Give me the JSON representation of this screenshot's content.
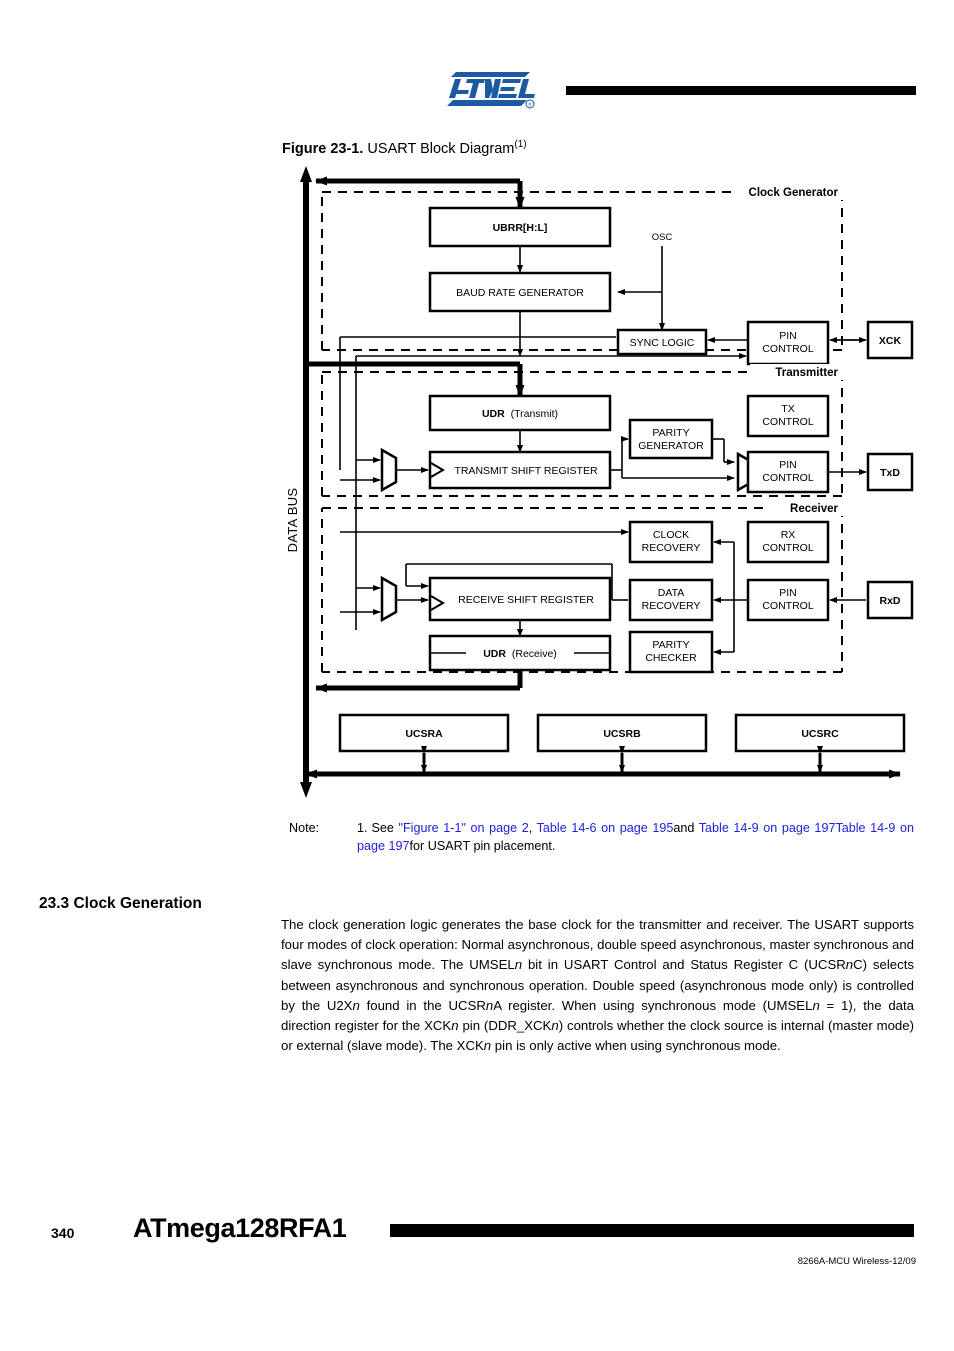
{
  "header": {
    "logo_text": "ATMEL",
    "logo_color": "#1C5BA4",
    "registered_mark": "®"
  },
  "figure": {
    "number": "Figure 23-1.",
    "title": "USART Block Diagram",
    "footnote_marker": "(1)",
    "databus_label": "DATA BUS",
    "sections": [
      {
        "id": "clock-generator",
        "label": "Clock Generator"
      },
      {
        "id": "transmitter",
        "label": "Transmitter"
      },
      {
        "id": "receiver",
        "label": "Receiver"
      }
    ],
    "blocks": {
      "ubrr": "UBRR[H:L]",
      "baud_rate_generator": "BAUD RATE GENERATOR",
      "osc": "OSC",
      "sync_logic": "SYNC LOGIC",
      "clk_pin_control": "PIN\nCONTROL",
      "udr_transmit_bold": "UDR",
      "udr_transmit_plain": "(Transmit)",
      "transmit_shift_register": "TRANSMIT SHIFT REGISTER",
      "parity_generator": "PARITY\nGENERATOR",
      "tx_control": "TX\nCONTROL",
      "tx_pin_control": "PIN\nCONTROL",
      "clock_recovery": "CLOCK\nRECOVERY",
      "rx_control": "RX\nCONTROL",
      "receive_shift_register": "RECEIVE SHIFT REGISTER",
      "data_recovery": "DATA\nRECOVERY",
      "rx_pin_control": "PIN\nCONTROL",
      "udr_receive_bold": "UDR",
      "udr_receive_plain": "(Receive)",
      "parity_checker": "PARITY\nCHECKER"
    },
    "pins": {
      "xck": "XCK",
      "txd": "TxD",
      "rxd": "RxD"
    },
    "registers": [
      {
        "id": "ucsra",
        "label": "UCSRA"
      },
      {
        "id": "ucsrb",
        "label": "UCSRB"
      },
      {
        "id": "ucsrc",
        "label": "UCSRC"
      }
    ]
  },
  "note": {
    "label": "Note:",
    "number": "1.",
    "lead": "See ",
    "links": [
      "\"Figure 1-1\" on page 2",
      "Table 14-6 on page 195",
      "Table 14-9 on page 197",
      "Table 14-9 on page 197"
    ],
    "sep_comma": ", ",
    "sep_and": "and ",
    "tail": "for USART pin placement.",
    "link_color": "#2020E0"
  },
  "section": {
    "heading": "23.3 Clock Generation",
    "paragraph_parts": [
      {
        "text": "The clock generation logic generates the base clock for the transmitter and receiver. The USART supports four modes of clock operation: Normal asynchronous, double speed asynchronous, master synchronous and slave synchronous mode. The UMSEL",
        "style": "normal"
      },
      {
        "text": "n",
        "style": "italic"
      },
      {
        "text": " bit in USART Control and Status Register C (UCSR",
        "style": "normal"
      },
      {
        "text": "n",
        "style": "italic"
      },
      {
        "text": "C) selects between asynchronous and synchronous operation. Double speed (asynchronous mode only) is controlled by the U2X",
        "style": "normal"
      },
      {
        "text": "n",
        "style": "italic"
      },
      {
        "text": " found in the UCSR",
        "style": "normal"
      },
      {
        "text": "n",
        "style": "italic"
      },
      {
        "text": "A register. When using synchronous mode (UMSEL",
        "style": "normal"
      },
      {
        "text": "n",
        "style": "italic"
      },
      {
        "text": " = 1), the data direction register for the XCK",
        "style": "normal"
      },
      {
        "text": "n",
        "style": "italic"
      },
      {
        "text": " pin (DDR_XCK",
        "style": "normal"
      },
      {
        "text": "n",
        "style": "italic"
      },
      {
        "text": ") controls whether the clock source is internal (master mode) or external (slave mode). The XCK",
        "style": "normal"
      },
      {
        "text": "n",
        "style": "italic"
      },
      {
        "text": " pin is only active when using synchronous mode.",
        "style": "normal"
      }
    ]
  },
  "footer": {
    "page_number": "340",
    "device_name": "ATmega128RFA1",
    "document_number": "8266A-MCU Wireless-12/09"
  }
}
